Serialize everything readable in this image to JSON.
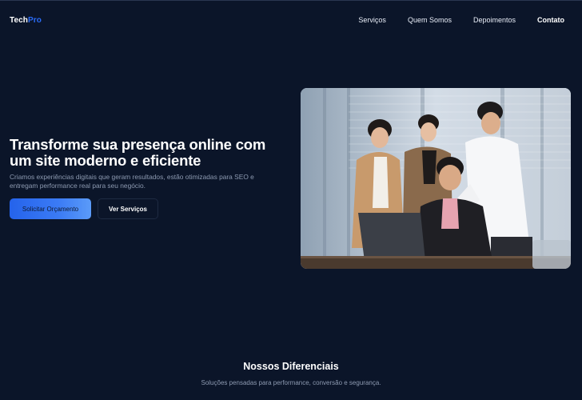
{
  "brand": {
    "part1": "Tech",
    "part2": "Pro",
    "accent_color": "#2b6cf6"
  },
  "nav": [
    {
      "label": "Serviços"
    },
    {
      "label": "Quem Somos"
    },
    {
      "label": "Depoimentos"
    },
    {
      "label": "Contato"
    }
  ],
  "hero": {
    "title": "Transforme sua presença online com um site moderno e eficiente",
    "subtitle": "Criamos experiências digitais que geram resultados, estão otimizadas para SEO e entregam performance real para seu negócio.",
    "primary_cta": "Solicitar Orçamento",
    "secondary_cta": "Ver Serviços",
    "image_description": "team-meeting-photo"
  },
  "features": {
    "title": "Nossos Diferenciais",
    "subtitle": "Soluções pensadas para performance, conversão e segurança."
  },
  "colors": {
    "background": "#0b1529",
    "muted_text": "#8d9ab1",
    "primary_button": "#2563eb"
  }
}
